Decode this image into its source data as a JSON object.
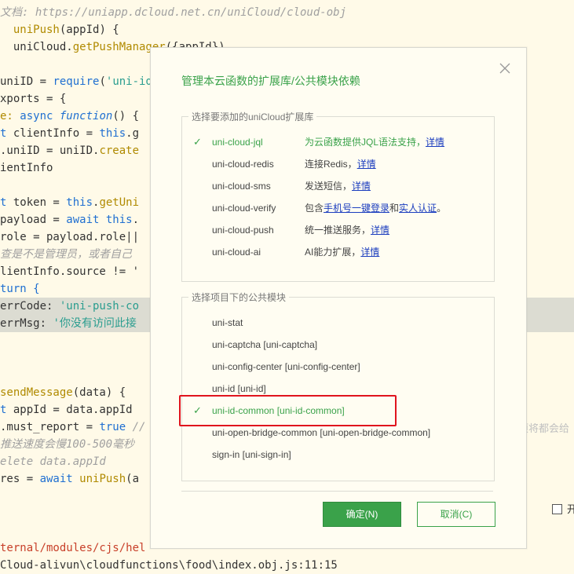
{
  "editor": {
    "lines": [
      {
        "tokens": [
          {
            "text": "文档: https://uniapp.dcloud.net.cn/uniCloud/cloud-obj",
            "c": "cmt"
          }
        ]
      },
      {
        "tokens": [
          {
            "text": "  ",
            "c": "plain"
          },
          {
            "text": "uniPush",
            "c": "fn"
          },
          {
            "text": "(appId) {",
            "c": "plain"
          }
        ]
      },
      {
        "tokens": [
          {
            "text": "  uniCloud.",
            "c": "plain"
          },
          {
            "text": "getPushManager",
            "c": "fn"
          },
          {
            "text": "({appId})",
            "c": "plain"
          }
        ]
      },
      {
        "tokens": []
      },
      {
        "tokens": [
          {
            "text": "uniID = ",
            "c": "plain"
          },
          {
            "text": "require",
            "c": "kw"
          },
          {
            "text": "(",
            "c": "plain"
          },
          {
            "text": "'uni-id",
            "c": "str"
          }
        ]
      },
      {
        "tokens": [
          {
            "text": "xports = {",
            "c": "plain"
          }
        ]
      },
      {
        "tokens": [
          {
            "text": "e: ",
            "c": "fn"
          },
          {
            "text": "async ",
            "c": "kw"
          },
          {
            "text": "function",
            "c": "italic"
          },
          {
            "text": "() {",
            "c": "plain"
          }
        ]
      },
      {
        "tokens": [
          {
            "text": "t ",
            "c": "kw"
          },
          {
            "text": "clientInfo = ",
            "c": "plain"
          },
          {
            "text": "this",
            "c": "kw"
          },
          {
            "text": ".g",
            "c": "plain"
          }
        ]
      },
      {
        "tokens": [
          {
            "text": ".uniID = uniID.",
            "c": "plain"
          },
          {
            "text": "create",
            "c": "fn"
          }
        ]
      },
      {
        "tokens": [
          {
            "text": "ientInfo",
            "c": "plain"
          }
        ]
      },
      {
        "tokens": []
      },
      {
        "tokens": [
          {
            "text": "t ",
            "c": "kw"
          },
          {
            "text": "token = ",
            "c": "plain"
          },
          {
            "text": "this",
            "c": "kw"
          },
          {
            "text": ".",
            "c": "plain"
          },
          {
            "text": "getUni",
            "c": "fn"
          }
        ]
      },
      {
        "tokens": [
          {
            "text": "payload = ",
            "c": "plain"
          },
          {
            "text": "await ",
            "c": "kw"
          },
          {
            "text": "this",
            "c": "kw"
          },
          {
            "text": ".",
            "c": "plain"
          }
        ]
      },
      {
        "tokens": [
          {
            "text": "role = payload.role||",
            "c": "plain"
          }
        ]
      },
      {
        "tokens": [
          {
            "text": "查是不是管理员，或者自己",
            "c": "cmt"
          }
        ]
      },
      {
        "tokens": [
          {
            "text": "lientInfo.source != '",
            "c": "plain"
          }
        ]
      },
      {
        "tokens": [
          {
            "text": "turn {",
            "c": "kw"
          }
        ]
      },
      {
        "tokens": [
          {
            "text": "errCode: ",
            "c": "plain"
          },
          {
            "text": "'uni-push-co",
            "c": "str"
          }
        ],
        "hl": true
      },
      {
        "tokens": [
          {
            "text": "errMsg: ",
            "c": "plain"
          },
          {
            "text": "'你没有访问此接",
            "c": "str"
          }
        ],
        "hl": true
      },
      {
        "tokens": []
      },
      {
        "tokens": []
      },
      {
        "tokens": []
      },
      {
        "tokens": [
          {
            "text": "sendMessage",
            "c": "fn"
          },
          {
            "text": "(data) {",
            "c": "plain"
          }
        ]
      },
      {
        "tokens": [
          {
            "text": "t ",
            "c": "kw"
          },
          {
            "text": "appId = data.appId",
            "c": "plain"
          }
        ]
      },
      {
        "tokens": [
          {
            "text": ".must_report = ",
            "c": "plain"
          },
          {
            "text": "true ",
            "c": "kw"
          },
          {
            "text": "//",
            "c": "cmt"
          }
        ]
      },
      {
        "tokens": [
          {
            "text": "推送速度会慢100-500毫秒",
            "c": "cmt"
          }
        ]
      },
      {
        "tokens": [
          {
            "text": "elete data.appId",
            "c": "cmt"
          }
        ]
      },
      {
        "tokens": [
          {
            "text": "res = ",
            "c": "plain"
          },
          {
            "text": "await ",
            "c": "kw"
          },
          {
            "text": "uniPush",
            "c": "fn"
          },
          {
            "text": "(a",
            "c": "plain"
          }
        ]
      },
      {
        "tokens": []
      },
      {
        "tokens": []
      },
      {
        "tokens": []
      },
      {
        "tokens": [
          {
            "text": "ternal/modules/cjs/hel",
            "c": "err"
          }
        ]
      },
      {
        "tokens": [
          {
            "text": "Cloud-alivun\\cloudfunctions\\food\\index.obj.js:11:15",
            "c": "plain"
          }
        ]
      }
    ],
    "right_fragment": "项将都会给",
    "right_checkbox_label": "开"
  },
  "dialog": {
    "title": "管理本云函数的扩展库/公共模块依赖",
    "extensions_legend": "选择要添加的uniCloud扩展库",
    "extensions": [
      {
        "name": "uni-cloud-jql",
        "desc": "为云函数提供JQL语法支持，",
        "link": "详情",
        "selected": true
      },
      {
        "name": "uni-cloud-redis",
        "desc": "连接Redis，",
        "link": "详情",
        "selected": false
      },
      {
        "name": "uni-cloud-sms",
        "desc": "发送短信，",
        "link": "详情",
        "selected": false
      },
      {
        "name": "uni-cloud-verify",
        "desc": "包含",
        "link": "手机号一键登录",
        "desc2": "和",
        "link2": "实人认证",
        "desc3": "。",
        "selected": false
      },
      {
        "name": "uni-cloud-push",
        "desc": "统一推送服务，",
        "link": "详情",
        "selected": false
      },
      {
        "name": "uni-cloud-ai",
        "desc": "AI能力扩展，",
        "link": "详情",
        "selected": false
      }
    ],
    "modules_legend": "选择项目下的公共模块",
    "modules": [
      {
        "name": "uni-stat",
        "selected": false
      },
      {
        "name": "uni-captcha [uni-captcha]",
        "selected": false
      },
      {
        "name": "uni-config-center [uni-config-center]",
        "selected": false
      },
      {
        "name": "uni-id [uni-id]",
        "selected": false
      },
      {
        "name": "uni-id-common [uni-id-common]",
        "selected": true
      },
      {
        "name": "uni-open-bridge-common [uni-open-bridge-common]",
        "selected": false
      },
      {
        "name": "sign-in [uni-sign-in]",
        "selected": false
      }
    ],
    "ok_label": "确定(N)",
    "cancel_label": "取消(C)",
    "check_glyph": "✓",
    "colors": {
      "accent": "#3aa24a",
      "link": "#1a3cbe",
      "highlight_box": "#e0141e"
    }
  }
}
